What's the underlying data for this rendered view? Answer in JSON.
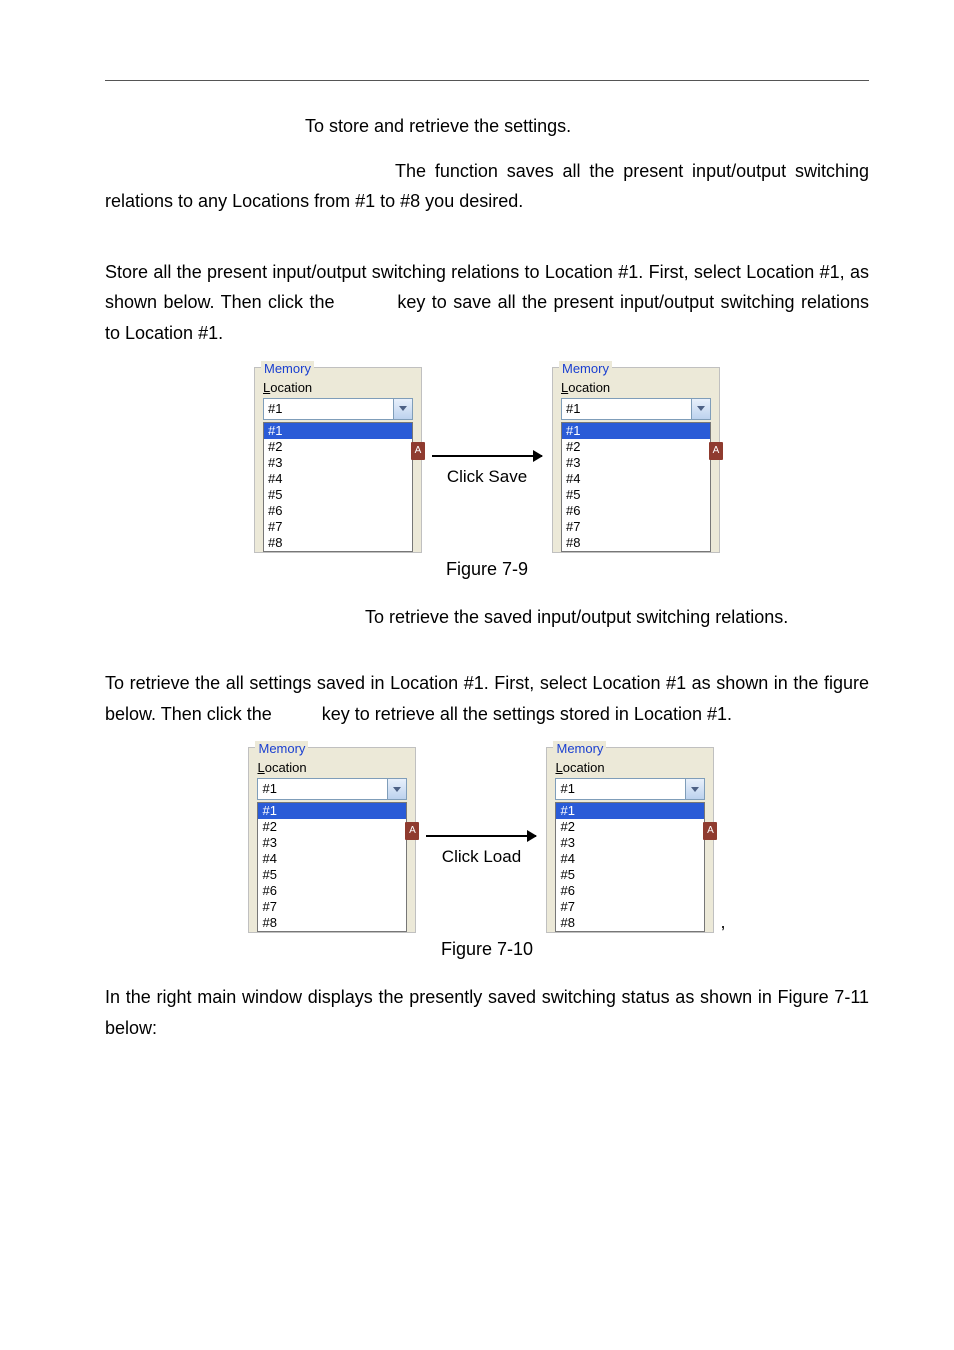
{
  "hr": "",
  "para1": "To store and retrieve the settings.",
  "para2": "The function saves all the present input/output switching relations to any Locations from #1 to #8 you desired.",
  "para3a": "Store all the present input/output switching relations to Location #1. First, select Location #1, as shown below. Then click the ",
  "para3b": " key to save all the present input/output switching relations to Location #1.",
  "fig1": {
    "left_title": "Memory",
    "loc_label_prefix": "L",
    "loc_label_rest": "ocation",
    "combo_value": "#1",
    "items": [
      "#1",
      "#2",
      "#3",
      "#4",
      "#5",
      "#6",
      "#7",
      "#8"
    ],
    "arrow_label": "Click Save",
    "caption": "Figure 7-9",
    "corner": "A"
  },
  "para4": "To retrieve the saved input/output switching relations.",
  "para5a": "To retrieve the all settings saved in Location #1. First, select Location #1 as shown in the figure below. Then click the ",
  "para5b": " key to retrieve all the settings stored in Location #1.",
  "fig2": {
    "left_title": "Memory",
    "loc_label_prefix": "L",
    "loc_label_rest": "ocation",
    "combo_value": "#1",
    "items": [
      "#1",
      "#2",
      "#3",
      "#4",
      "#5",
      "#6",
      "#7",
      "#8"
    ],
    "arrow_label": "Click Load",
    "caption": "Figure 7-10",
    "corner": "A",
    "trailing_comma": ","
  },
  "para6": "In the right main window displays the presently saved switching status as shown in Figure 7-11 below:"
}
